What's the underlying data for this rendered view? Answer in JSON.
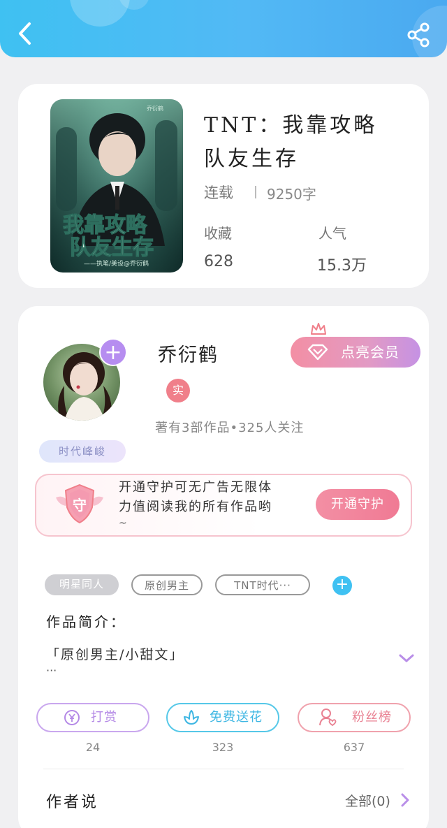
{
  "header": {
    "back_icon": "chevron-left-icon",
    "share_icon": "share-icon"
  },
  "book": {
    "title_line1": "TNT：我靠攻略",
    "title_line2": "队友生存",
    "status": "连载",
    "word_count": "9250字",
    "favorites_label": "收藏",
    "favorites_value": "628",
    "popularity_label": "人气",
    "popularity_value": "15.3万",
    "cover": {
      "title_line1": "我靠攻略",
      "title_line2": "队友生存",
      "credit": "——执笔/美设@乔衍鹤",
      "author_mark": "乔衍鹤"
    }
  },
  "author": {
    "name": "乔衍鹤",
    "verified_badge": "实",
    "meta": "著有3部作品•325人关注",
    "tag": "时代峰峻",
    "vip_button": "点亮会员"
  },
  "guard": {
    "icon_char": "守",
    "text_line1": "开通守护可无广告无限体",
    "text_line2": "力值阅读我的所有作品哟",
    "text_line3": "~",
    "button": "开通守护"
  },
  "tags": [
    "明星同人",
    "原创男主",
    "TNT时代···"
  ],
  "intro": {
    "heading": "作品简介：",
    "text": "「原创男主/小甜文」",
    "more": "···"
  },
  "actions": [
    {
      "label": "打赏",
      "count": "24",
      "icon": "yen-coin-icon"
    },
    {
      "label": "免费送花",
      "count": "323",
      "icon": "flower-icon"
    },
    {
      "label": "粉丝榜",
      "count": "637",
      "icon": "fan-user-icon"
    }
  ],
  "author_says": {
    "title": "作者说",
    "all_label": "全部(0)"
  },
  "colors": {
    "header_blue": "#4ab8f4",
    "vip_pink": "#f38fa4",
    "accent_purple": "#b68df0"
  }
}
